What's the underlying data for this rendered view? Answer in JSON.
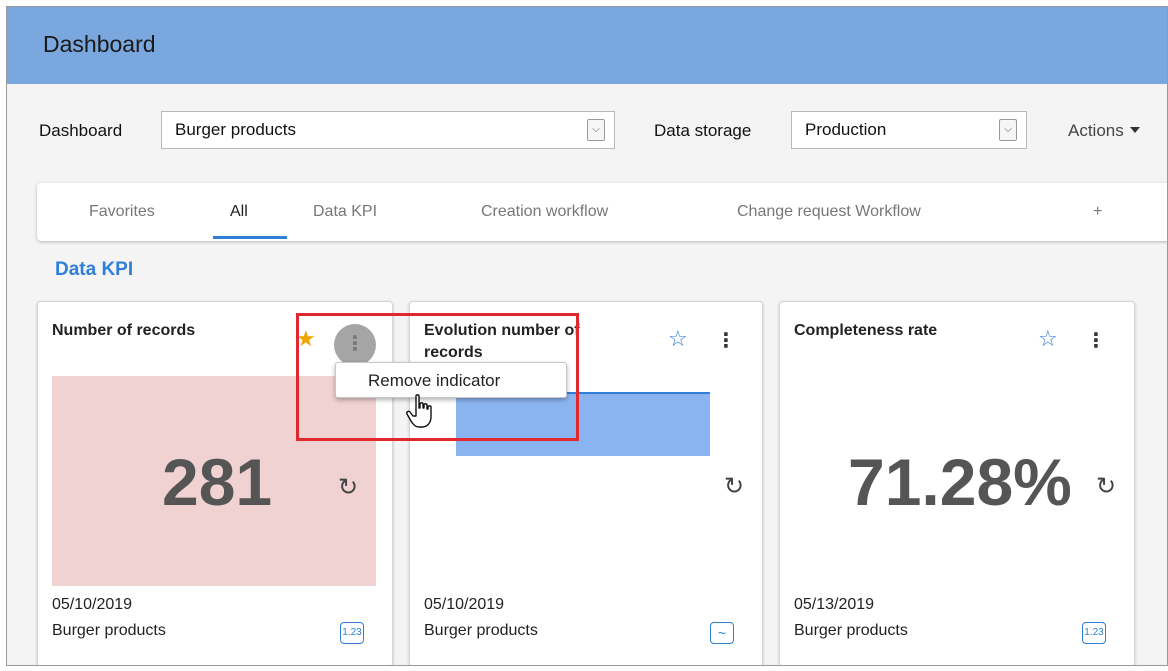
{
  "header": {
    "title": "Dashboard"
  },
  "filters": {
    "dashboard_label": "Dashboard",
    "dashboard_value": "Burger products",
    "storage_label": "Data storage",
    "storage_value": "Production",
    "actions_label": "Actions"
  },
  "tabs": [
    {
      "label": "Favorites"
    },
    {
      "label": "All"
    },
    {
      "label": "Data KPI"
    },
    {
      "label": "Creation workflow"
    },
    {
      "label": "Change request Workflow"
    },
    {
      "label": "+"
    }
  ],
  "section": {
    "title": "Data KPI"
  },
  "cards": [
    {
      "title": "Number of records",
      "value": "281",
      "date": "05/10/2019",
      "subtitle": "Burger products",
      "badge": "1.23",
      "favorite": true,
      "tile_color": "#f0d2d2"
    },
    {
      "title": "Evolution number of records",
      "date": "05/10/2019",
      "subtitle": "Burger products",
      "badge": "~",
      "favorite": false,
      "chart_color": "#8ab4f0"
    },
    {
      "title": "Completeness rate",
      "value": "71.28%",
      "date": "05/13/2019",
      "subtitle": "Burger products",
      "badge": "1.23",
      "favorite": false
    }
  ],
  "context_menu": {
    "item": "Remove indicator"
  },
  "colors": {
    "accent": "#2f7fd8",
    "header": "#7aa7de",
    "star_filled": "#f0a400",
    "highlight": "#e0282e"
  },
  "icons": {
    "star": "star-icon",
    "kebab": "kebab-menu-icon",
    "refresh": "refresh-icon",
    "cursor": "hand-pointer-icon"
  }
}
